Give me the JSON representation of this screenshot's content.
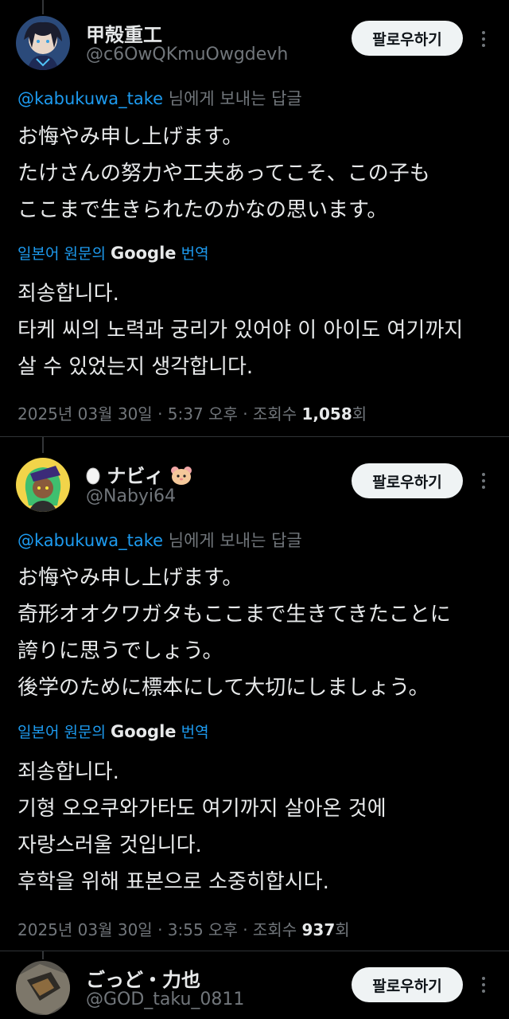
{
  "follow_label": "팔로우하기",
  "reply_suffix": "님에게 보내는 답글",
  "translate": {
    "prefix": "일본어 원문의",
    "brand": "Google",
    "suffix": "번역"
  },
  "tweets": [
    {
      "name": "甲殻重工",
      "handle": "@c6OwQKmuOwgdevh",
      "reply_to": "@kabukuwa_take",
      "original": [
        "お悔やみ申し上げます。",
        "たけさんの努力や工夫あってこそ、この子も",
        "ここまで生きられたのかなの思います。"
      ],
      "translated": [
        "죄송합니다.",
        "타케 씨의 노력과 궁리가 있어야 이 아이도 여기까지",
        "살 수 있었는지 생각합니다."
      ],
      "timestamp": "2025년 03월 30일 · 5:37 오후 · 조회수",
      "views": "1,058",
      "views_unit": "회"
    },
    {
      "name": "ナビィ",
      "name_prefix_emoji": "egg-icon",
      "name_suffix_emoji": "hamster-icon",
      "handle": "@Nabyi64",
      "reply_to": "@kabukuwa_take",
      "original": [
        "お悔やみ申し上げます。",
        "奇形オオクワガタもここまで生きてきたことに",
        "誇りに思うでしょう。",
        "後学のために標本にして大切にしましょう。"
      ],
      "translated": [
        "죄송합니다.",
        "기형 오오쿠와가타도 여기까지 살아온 것에",
        "자랑스러울 것입니다.",
        "후학을 위해 표본으로 소중히합시다."
      ],
      "timestamp": "2025년 03월 30일 · 3:55 오후 · 조회수",
      "views": "937",
      "views_unit": "회"
    },
    {
      "name": "ごっど・力也",
      "handle": "@GOD_taku_0811"
    }
  ],
  "colors": {
    "background": "#000000",
    "accent": "#1d9bf0",
    "muted": "#71767b",
    "text": "#e7e9ea"
  }
}
